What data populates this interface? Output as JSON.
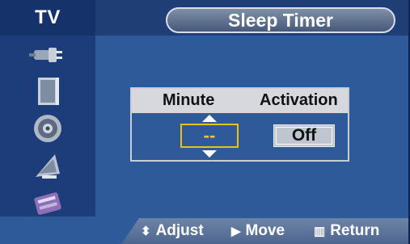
{
  "header": {
    "source_label": "TV",
    "menu_title": "Sleep Timer"
  },
  "sidebar": {
    "items": [
      {
        "icon": "input-plug-icon"
      },
      {
        "icon": "picture-panel-icon"
      },
      {
        "icon": "sound-speaker-icon"
      },
      {
        "icon": "channel-antenna-icon"
      },
      {
        "icon": "setup-tools-icon"
      }
    ]
  },
  "dialog": {
    "col_minute": "Minute",
    "col_activation": "Activation",
    "minute_value": "--",
    "activation_value": "Off"
  },
  "footer": {
    "adjust_label": "Adjust",
    "move_label": "Move",
    "return_label": "Return"
  },
  "colors": {
    "background": "#2f5a9a",
    "highlight": "#e8c21c"
  }
}
